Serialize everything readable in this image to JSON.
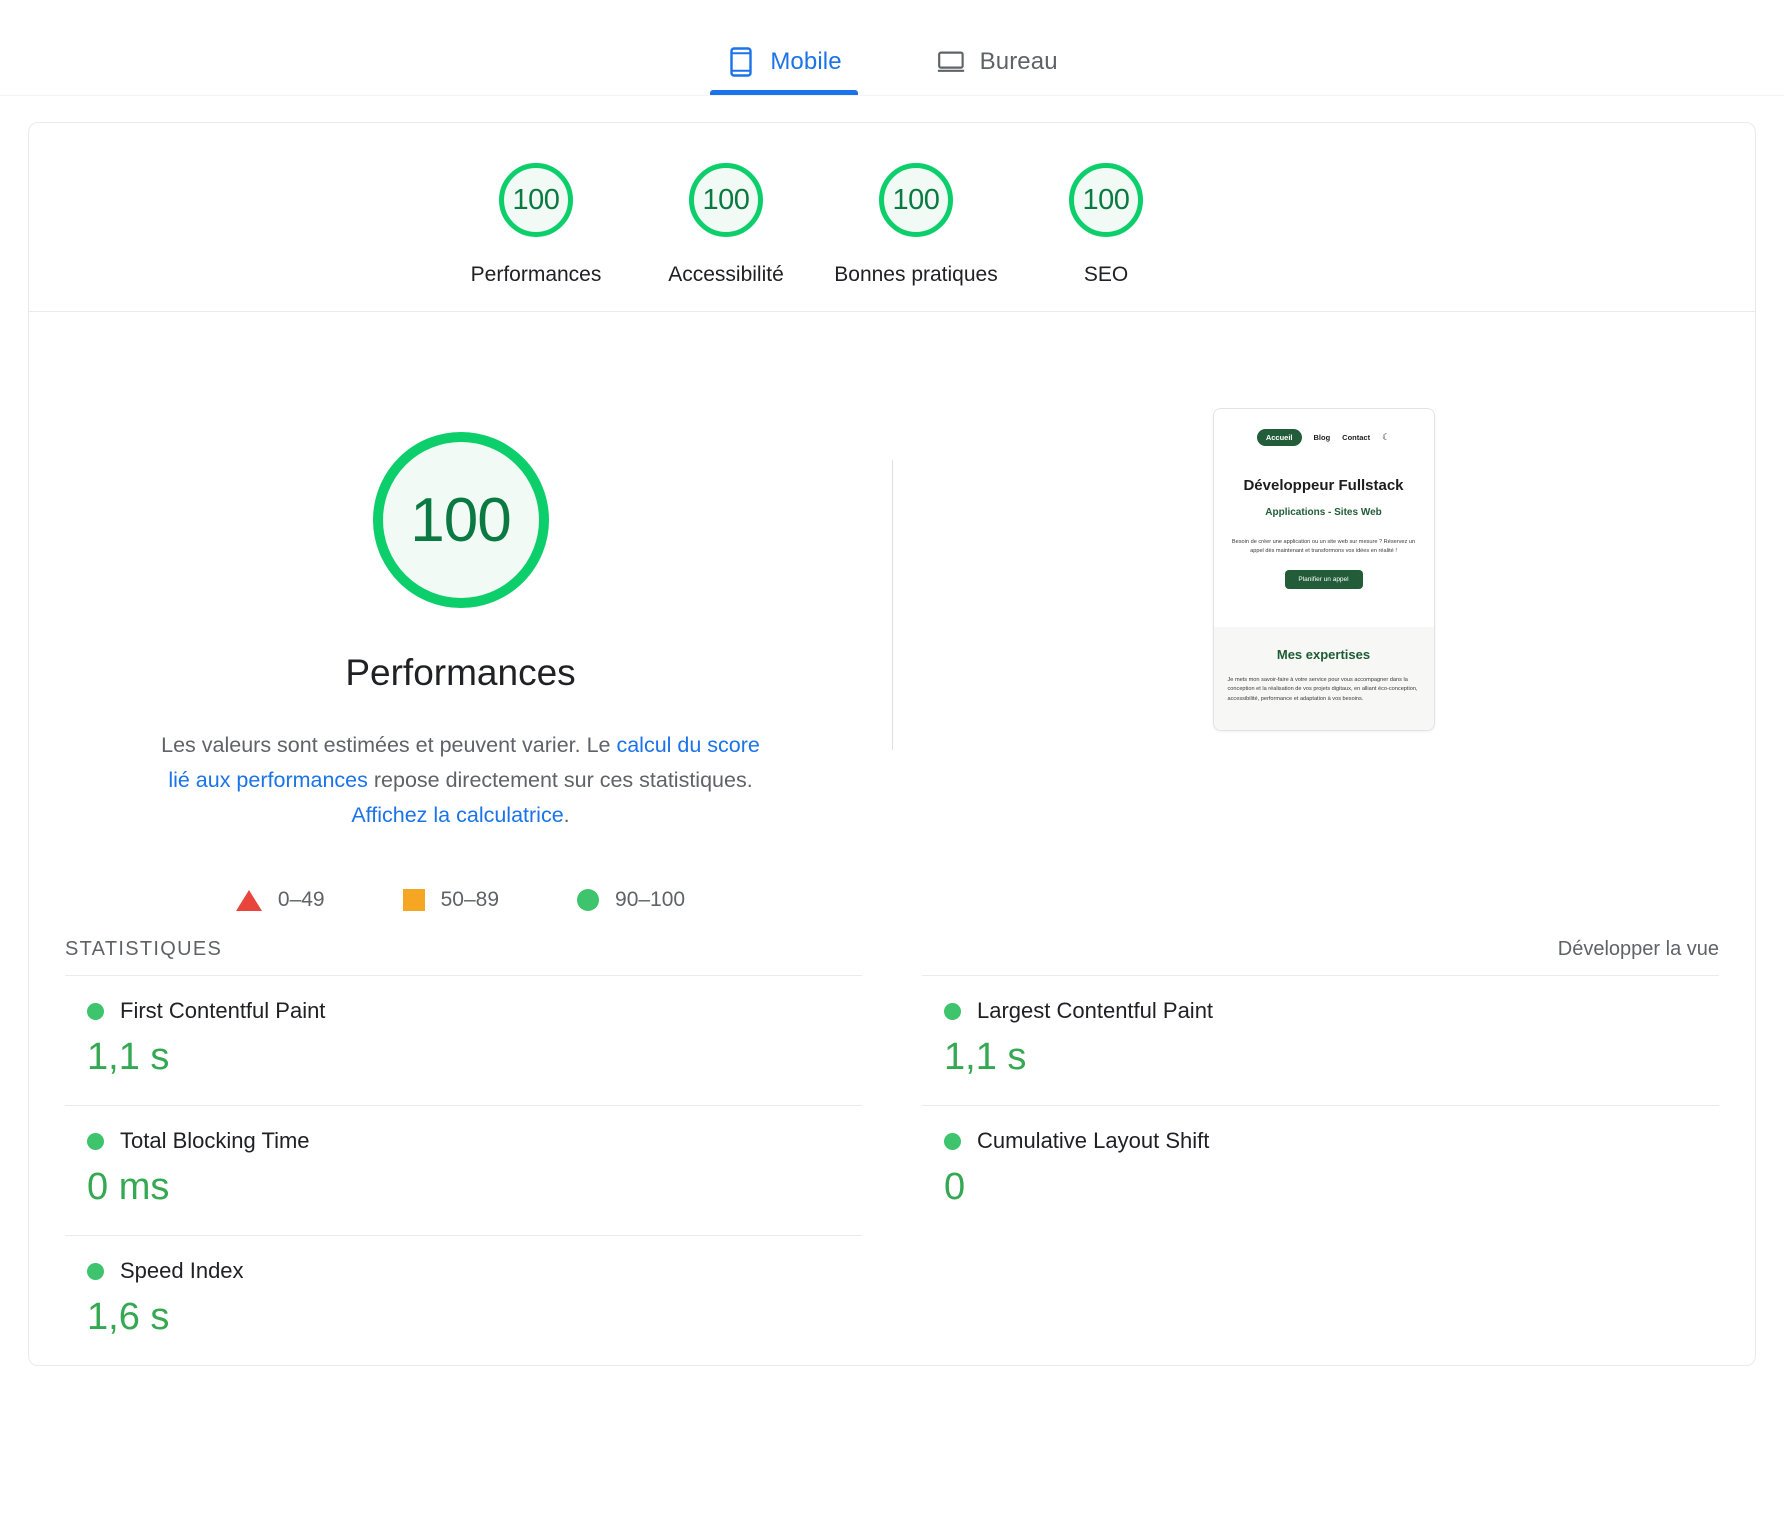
{
  "device_tabs": [
    {
      "label": "Mobile",
      "icon": "mobile-phone-icon",
      "active": true
    },
    {
      "label": "Bureau",
      "icon": "laptop-icon",
      "active": false
    }
  ],
  "summary_gauges": [
    {
      "score": "100",
      "label": "Performances"
    },
    {
      "score": "100",
      "label": "Accessibilité"
    },
    {
      "score": "100",
      "label": "Bonnes pratiques"
    },
    {
      "score": "100",
      "label": "SEO"
    }
  ],
  "detail": {
    "score": "100",
    "title": "Performances",
    "description": {
      "part1": "Les valeurs sont estimées et peuvent varier. Le ",
      "link1": "calcul du score lié aux performances",
      "part2": " repose directement sur ces statistiques. ",
      "link2": "Affichez la calculatrice",
      "part3": "."
    }
  },
  "legend": [
    {
      "shape": "triangle",
      "color": "#e8453c",
      "range": "0–49"
    },
    {
      "shape": "square",
      "color": "#f5a623",
      "range": "50–89"
    },
    {
      "shape": "circle",
      "color": "#3dc46c",
      "range": "90–100"
    }
  ],
  "thumbnail": {
    "nav": {
      "pill": "Accueil",
      "links": [
        "Blog",
        "Contact"
      ],
      "theme_icon": "moon-icon"
    },
    "heading": "Développeur Fullstack",
    "subheading": "Applications - Sites Web",
    "intro": "Besoin de créer une application ou un site web sur mesure ? Réservez un appel dès maintenant et transformons vos idées en réalité !",
    "cta": "Planifier un appel",
    "section_title": "Mes expertises",
    "section_body": "Je mets mon savoir-faire à votre service pour vous accompagner dans la conception et la réalisation de vos projets digitaux, en alliant éco-conception, accessibilité, performance et adaptation à vos besoins."
  },
  "statistics": {
    "title": "STATISTIQUES",
    "expand_label": "Développer la vue",
    "metrics": [
      {
        "name": "First Contentful Paint",
        "value": "1,1 s",
        "status_color": "#3dc46c"
      },
      {
        "name": "Largest Contentful Paint",
        "value": "1,1 s",
        "status_color": "#3dc46c"
      },
      {
        "name": "Total Blocking Time",
        "value": "0 ms",
        "status_color": "#3dc46c"
      },
      {
        "name": "Cumulative Layout Shift",
        "value": "0",
        "status_color": "#3dc46c"
      },
      {
        "name": "Speed Index",
        "value": "1,6 s",
        "status_color": "#3dc46c"
      }
    ]
  },
  "colors": {
    "pass_green": "#0cce6b",
    "value_green": "#34a853",
    "average_orange": "#f5a623",
    "fail_red": "#e8453c",
    "link_blue": "#1a73e8"
  }
}
